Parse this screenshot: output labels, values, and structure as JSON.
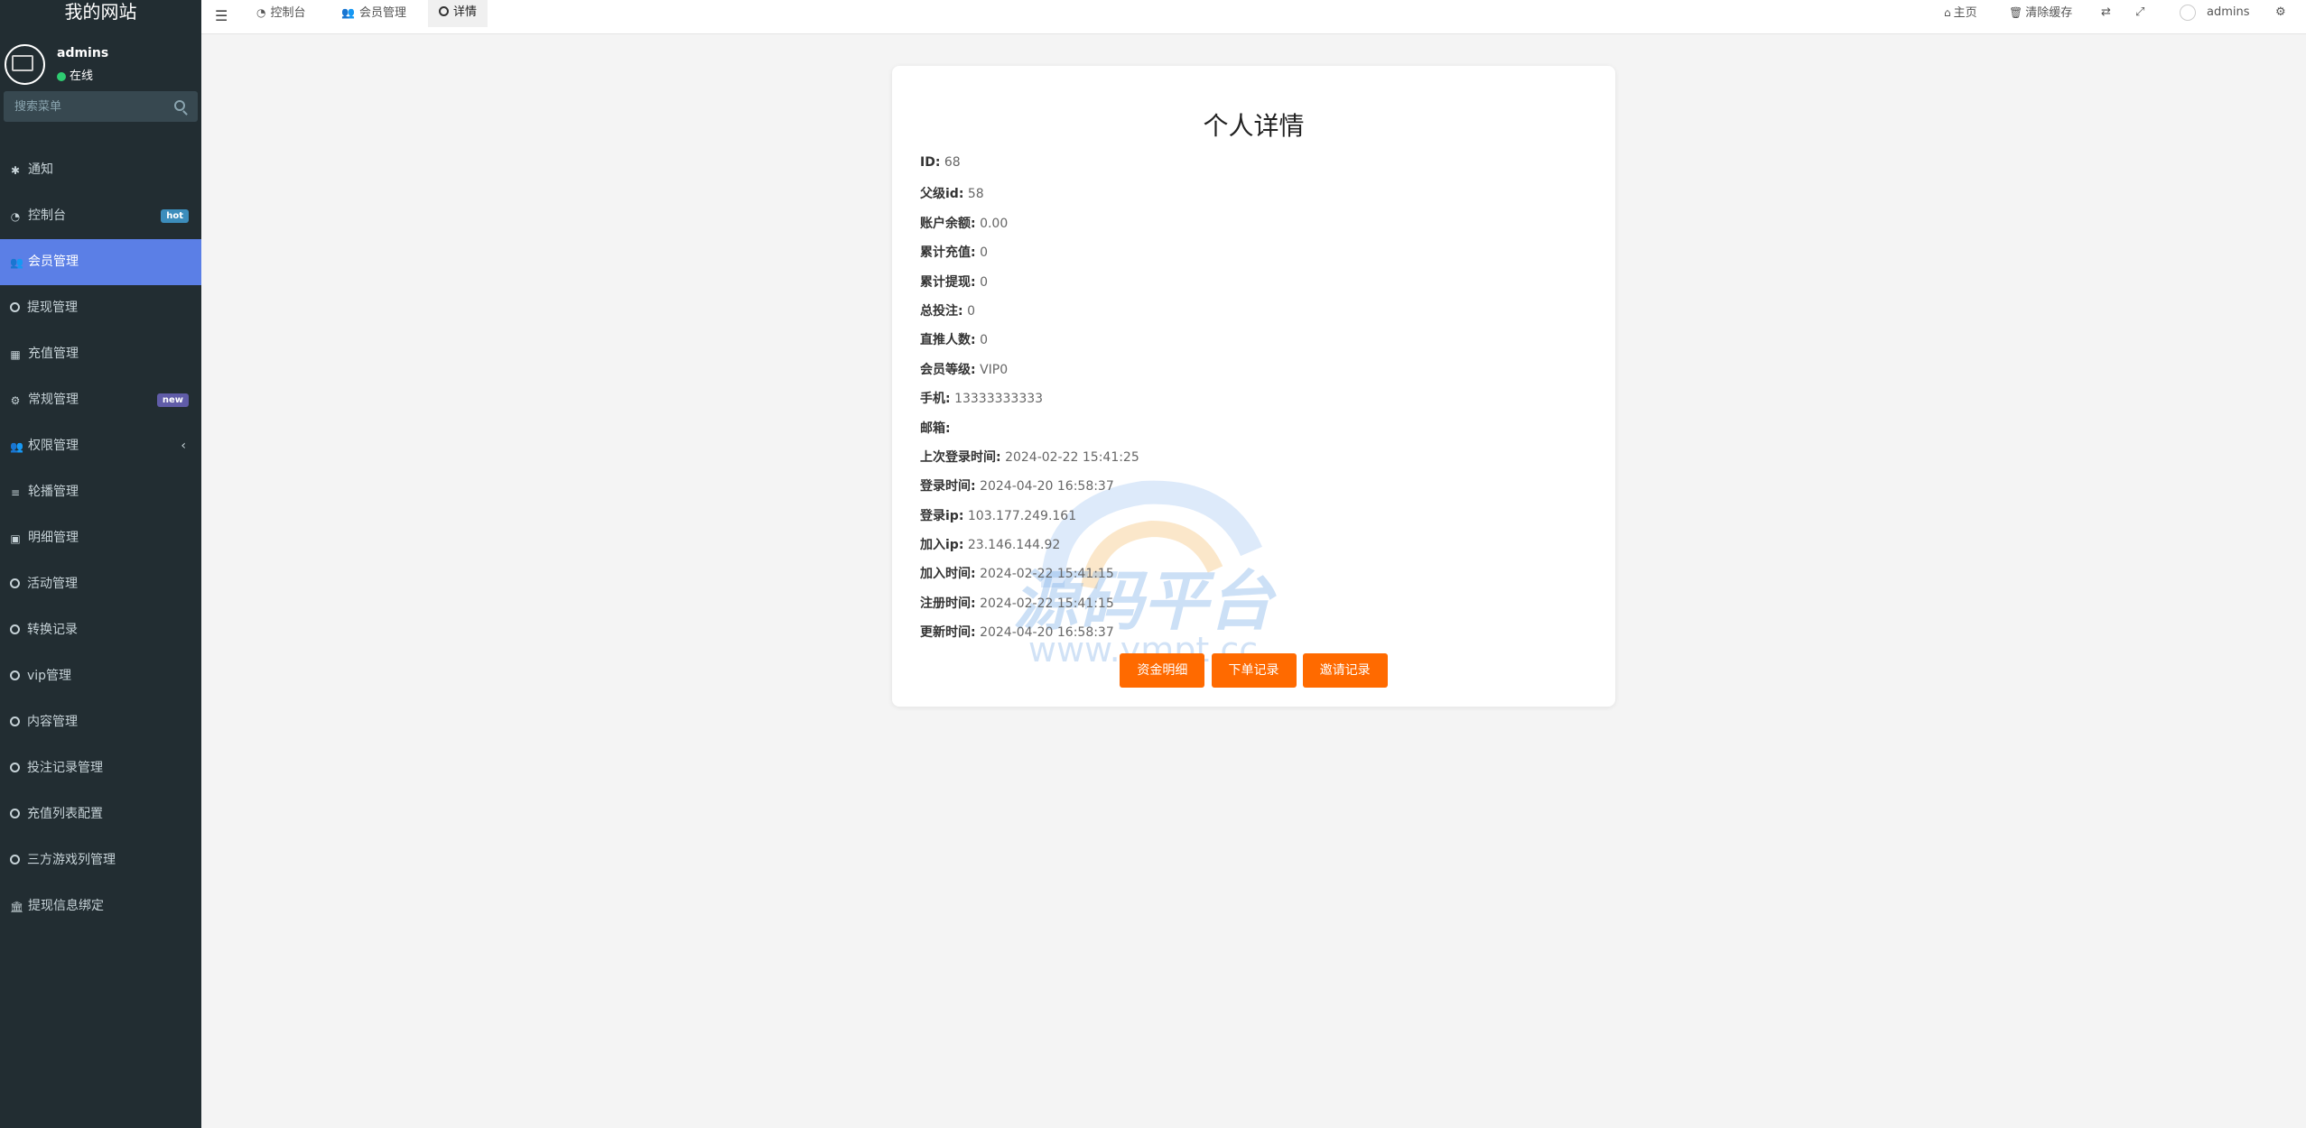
{
  "sidebar": {
    "site_title": "我的网站",
    "user": {
      "name": "admins",
      "status": "在线"
    },
    "search_placeholder": "搜索菜单",
    "items": [
      {
        "label": "通知",
        "icon": "asterisk-icon"
      },
      {
        "label": "控制台",
        "icon": "dashboard-icon",
        "badge": "hot"
      },
      {
        "label": "会员管理",
        "icon": "users-icon",
        "active": true
      },
      {
        "label": "提现管理",
        "icon": "circle-icon"
      },
      {
        "label": "充值管理",
        "icon": "grid-icon"
      },
      {
        "label": "常规管理",
        "icon": "gears-icon",
        "badge": "new"
      },
      {
        "label": "权限管理",
        "icon": "group-icon"
      },
      {
        "label": "轮播管理",
        "icon": "list-icon"
      },
      {
        "label": "明细管理",
        "icon": "calendar-icon"
      },
      {
        "label": "活动管理",
        "icon": "circle-icon"
      },
      {
        "label": "转换记录",
        "icon": "circle-icon"
      },
      {
        "label": "vip管理",
        "icon": "circle-icon"
      },
      {
        "label": "内容管理",
        "icon": "circle-icon"
      },
      {
        "label": "投注记录管理",
        "icon": "circle-icon"
      },
      {
        "label": "充值列表配置",
        "icon": "circle-icon"
      },
      {
        "label": "三方游戏列管理",
        "icon": "circle-icon"
      },
      {
        "label": "提现信息绑定",
        "icon": "bank-icon"
      }
    ]
  },
  "header": {
    "tabs": [
      {
        "label": "控制台",
        "icon": "dashboard-icon"
      },
      {
        "label": "会员管理",
        "icon": "users-icon"
      },
      {
        "label": "详情",
        "icon": "circle-icon",
        "active": true
      }
    ],
    "right": {
      "home_label": "主页",
      "clear_cache_label": "清除缓存",
      "user_name": "admins"
    }
  },
  "detail": {
    "title": "个人详情",
    "fields": [
      {
        "key": "ID:",
        "value": "68"
      },
      {
        "key": "父级id:",
        "value": "58"
      },
      {
        "key": "账户余额:",
        "value": "0.00"
      },
      {
        "key": "累计充值:",
        "value": "0"
      },
      {
        "key": "累计提现:",
        "value": "0"
      },
      {
        "key": "总投注:",
        "value": "0"
      },
      {
        "key": "直推人数:",
        "value": "0"
      },
      {
        "key": "会员等级:",
        "value": "VIP0"
      },
      {
        "key": "手机:",
        "value": "13333333333"
      },
      {
        "key": "邮箱:",
        "value": ""
      },
      {
        "key": "上次登录时间:",
        "value": "2024-02-22 15:41:25"
      },
      {
        "key": "登录时间:",
        "value": "2024-04-20 16:58:37"
      },
      {
        "key": "登录ip:",
        "value": "103.177.249.161"
      },
      {
        "key": "加入ip:",
        "value": "23.146.144.92"
      },
      {
        "key": "加入时间:",
        "value": "2024-02-22 15:41:15"
      },
      {
        "key": "注册时间:",
        "value": "2024-02-22 15:41:15"
      },
      {
        "key": "更新时间:",
        "value": "2024-04-20 16:58:37"
      }
    ],
    "buttons": [
      "资金明细",
      "下单记录",
      "邀请记录"
    ],
    "watermark": {
      "brand": "源码平台",
      "url": "www.ympt.cc"
    }
  },
  "colors": {
    "sidebar_bg": "#222d32",
    "active_menu": "#5b7fe6",
    "button": "#ff6a00",
    "badge_hot": "#3c8dbc",
    "badge_new": "#605ca8"
  }
}
